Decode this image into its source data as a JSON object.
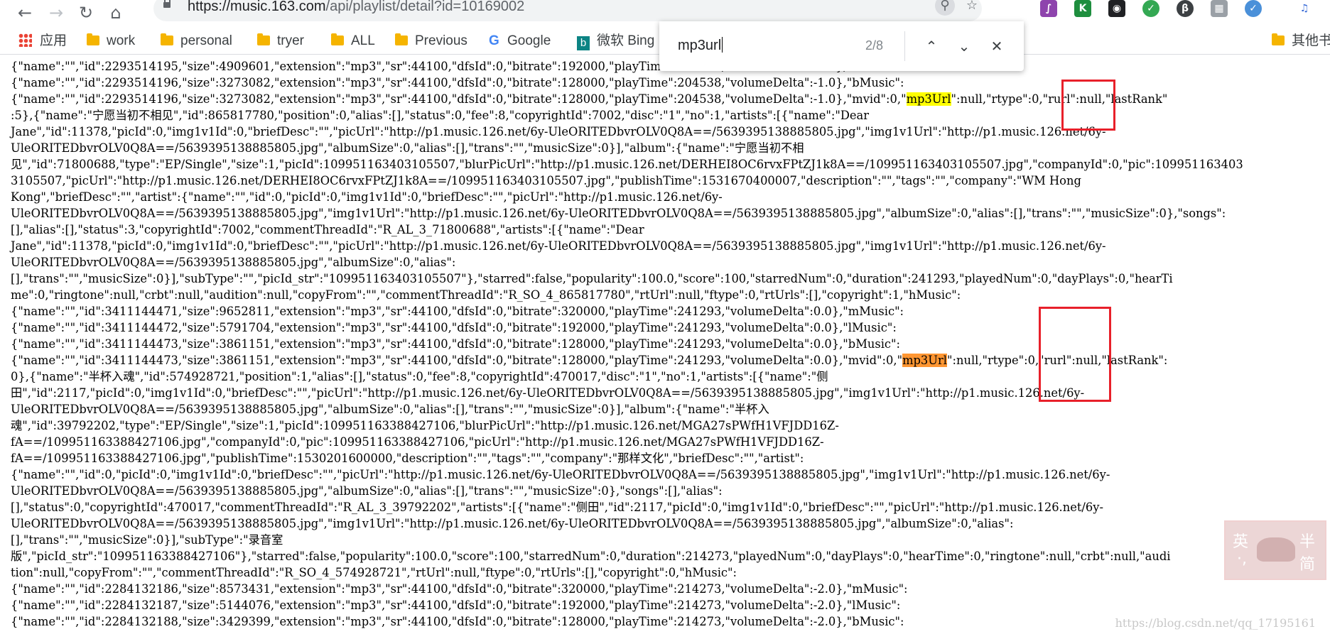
{
  "browser": {
    "url_host": "https://music.163.com",
    "url_path": "/api/playlist/detail?id=10169002",
    "bookmarks": [
      {
        "label": "应用",
        "icon": "apps-icon"
      },
      {
        "label": "work",
        "icon": "folder-icon"
      },
      {
        "label": "personal",
        "icon": "folder-icon"
      },
      {
        "label": "tryer",
        "icon": "folder-icon"
      },
      {
        "label": "ALL",
        "icon": "folder-icon"
      },
      {
        "label": "Previous",
        "icon": "folder-icon"
      },
      {
        "label": "Google",
        "icon": "google-icon"
      },
      {
        "label": "微软 Bing",
        "icon": "bing-icon"
      },
      {
        "label": "其他书",
        "icon": "folder-icon"
      }
    ]
  },
  "find_bar": {
    "query": "mp3url",
    "count": "2/8"
  },
  "content": {
    "segments": [
      {
        "text": "{\"name\":\"\",\"id\":2293514195,\"size\":4909601,\"extension\":\"mp3\",\"sr\":44100,\"dfsId\":0,\"bitrate\":192000,\"playTime\":204538,\"volumeDelta\":-1.0},\"lMusic\":\n{\"name\":\"\",\"id\":2293514196,\"size\":3273082,\"extension\":\"mp3\",\"sr\":44100,\"dfsId\":0,\"bitrate\":128000,\"playTime\":204538,\"volumeDelta\":-1.0},\"bMusic\":\n{\"name\":\"\",\"id\":2293514196,\"size\":3273082,\"extension\":\"mp3\",\"sr\":44100,\"dfsId\":0,\"bitrate\":128000,\"playTime\":204538,\"volumeDelta\":-1.0},\"mvid\":0,\"",
        "hl": ""
      },
      {
        "text": "mp3Url",
        "hl": "match"
      },
      {
        "text": "\":null,\"rtype\":0,\"rurl\":null,\"lastRank\"\n:5},{\"name\":\"宁愿当初不相见\",\"id\":865817780,\"position\":0,\"alias\":[],\"status\":0,\"fee\":8,\"copyrightId\":7002,\"disc\":\"1\",\"no\":1,\"artists\":[{\"name\":\"Dear\nJane\",\"id\":11378,\"picId\":0,\"img1v1Id\":0,\"briefDesc\":\"\",\"picUrl\":\"http://p1.music.126.net/6y-UleORITEDbvrOLV0Q8A==/5639395138885805.jpg\",\"img1v1Url\":\"http://p1.music.126.net/6y-\nUleORITEDbvrOLV0Q8A==/5639395138885805.jpg\",\"albumSize\":0,\"alias\":[],\"trans\":\"\",\"musicSize\":0}],\"album\":{\"name\":\"宁愿当初不相\n见\",\"id\":71800688,\"type\":\"EP/Single\",\"size\":1,\"picId\":109951163403105507,\"blurPicUrl\":\"http://p1.music.126.net/DERHEI8OC6rvxFPtZJ1k8A==/109951163403105507.jpg\",\"companyId\":0,\"pic\":109951163403\n3105507,\"picUrl\":\"http://p1.music.126.net/DERHEI8OC6rvxFPtZJ1k8A==/109951163403105507.jpg\",\"publishTime\":1531670400007,\"description\":\"\",\"tags\":\"\",\"company\":\"WM Hong\nKong\",\"briefDesc\":\"\",\"artist\":{\"name\":\"\",\"id\":0,\"picId\":0,\"img1v1Id\":0,\"briefDesc\":\"\",\"picUrl\":\"http://p1.music.126.net/6y-\nUleORITEDbvrOLV0Q8A==/5639395138885805.jpg\",\"img1v1Url\":\"http://p1.music.126.net/6y-UleORITEDbvrOLV0Q8A==/5639395138885805.jpg\",\"albumSize\":0,\"alias\":[],\"trans\":\"\",\"musicSize\":0},\"songs\":\n[],\"alias\":[],\"status\":3,\"copyrightId\":7002,\"commentThreadId\":\"R_AL_3_71800688\",\"artists\":[{\"name\":\"Dear\nJane\",\"id\":11378,\"picId\":0,\"img1v1Id\":0,\"briefDesc\":\"\",\"picUrl\":\"http://p1.music.126.net/6y-UleORITEDbvrOLV0Q8A==/5639395138885805.jpg\",\"img1v1Url\":\"http://p1.music.126.net/6y-\nUleORITEDbvrOLV0Q8A==/5639395138885805.jpg\",\"albumSize\":0,\"alias\":\n[],\"trans\":\"\",\"musicSize\":0}],\"subType\":\"\",\"picId_str\":\"109951163403105507\"},\"starred\":false,\"popularity\":100.0,\"score\":100,\"starredNum\":0,\"duration\":241293,\"playedNum\":0,\"dayPlays\":0,\"hearTi\nme\":0,\"ringtone\":null,\"crbt\":null,\"audition\":null,\"copyFrom\":\"\",\"commentThreadId\":\"R_SO_4_865817780\",\"rtUrl\":null,\"ftype\":0,\"rtUrls\":[],\"copyright\":1,\"hMusic\":\n{\"name\":\"\",\"id\":3411144471,\"size\":9652811,\"extension\":\"mp3\",\"sr\":44100,\"dfsId\":0,\"bitrate\":320000,\"playTime\":241293,\"volumeDelta\":0.0},\"mMusic\":\n{\"name\":\"\",\"id\":3411144472,\"size\":5791704,\"extension\":\"mp3\",\"sr\":44100,\"dfsId\":0,\"bitrate\":192000,\"playTime\":241293,\"volumeDelta\":0.0},\"lMusic\":\n{\"name\":\"\",\"id\":3411144473,\"size\":3861151,\"extension\":\"mp3\",\"sr\":44100,\"dfsId\":0,\"bitrate\":128000,\"playTime\":241293,\"volumeDelta\":0.0},\"bMusic\":\n{\"name\":\"\",\"id\":3411144473,\"size\":3861151,\"extension\":\"mp3\",\"sr\":44100,\"dfsId\":0,\"bitrate\":128000,\"playTime\":241293,\"volumeDelta\":0.0},\"mvid\":0,\"",
        "hl": ""
      },
      {
        "text": "mp3Url",
        "hl": "current"
      },
      {
        "text": "\":null,\"rtype\":0,\"rurl\":null,\"lastRank\":\n0},{\"name\":\"半杯入魂\",\"id\":574928721,\"position\":1,\"alias\":[],\"status\":0,\"fee\":8,\"copyrightId\":470017,\"disc\":\"1\",\"no\":1,\"artists\":[{\"name\":\"侧\n田\",\"id\":2117,\"picId\":0,\"img1v1Id\":0,\"briefDesc\":\"\",\"picUrl\":\"http://p1.music.126.net/6y-UleORITEDbvrOLV0Q8A==/5639395138885805.jpg\",\"img1v1Url\":\"http://p1.music.126.net/6y-\nUleORITEDbvrOLV0Q8A==/5639395138885805.jpg\",\"albumSize\":0,\"alias\":[],\"trans\":\"\",\"musicSize\":0}],\"album\":{\"name\":\"半杯入\n魂\",\"id\":39792202,\"type\":\"EP/Single\",\"size\":1,\"picId\":109951163388427106,\"blurPicUrl\":\"http://p1.music.126.net/MGA27sPWfH1VFJDD16Z-\nfA==/109951163388427106.jpg\",\"companyId\":0,\"pic\":109951163388427106,\"picUrl\":\"http://p1.music.126.net/MGA27sPWfH1VFJDD16Z-\nfA==/109951163388427106.jpg\",\"publishTime\":1530201600000,\"description\":\"\",\"tags\":\"\",\"company\":\"那样文化\",\"briefDesc\":\"\",\"artist\":\n{\"name\":\"\",\"id\":0,\"picId\":0,\"img1v1Id\":0,\"briefDesc\":\"\",\"picUrl\":\"http://p1.music.126.net/6y-UleORITEDbvrOLV0Q8A==/5639395138885805.jpg\",\"img1v1Url\":\"http://p1.music.126.net/6y-\nUleORITEDbvrOLV0Q8A==/5639395138885805.jpg\",\"albumSize\":0,\"alias\":[],\"trans\":\"\",\"musicSize\":0},\"songs\":[],\"alias\":\n[],\"status\":0,\"copyrightId\":470017,\"commentThreadId\":\"R_AL_3_39792202\",\"artists\":[{\"name\":\"侧田\",\"id\":2117,\"picId\":0,\"img1v1Id\":0,\"briefDesc\":\"\",\"picUrl\":\"http://p1.music.126.net/6y-\nUleORITEDbvrOLV0Q8A==/5639395138885805.jpg\",\"img1v1Url\":\"http://p1.music.126.net/6y-UleORITEDbvrOLV0Q8A==/5639395138885805.jpg\",\"albumSize\":0,\"alias\":\n[],\"trans\":\"\",\"musicSize\":0}],\"subType\":\"录音室\n版\",\"picId_str\":\"109951163388427106\"},\"starred\":false,\"popularity\":100.0,\"score\":100,\"starredNum\":0,\"duration\":214273,\"playedNum\":0,\"dayPlays\":0,\"hearTime\":0,\"ringtone\":null,\"crbt\":null,\"audi\ntion\":null,\"copyFrom\":\"\",\"commentThreadId\":\"R_SO_4_574928721\",\"rtUrl\":null,\"ftype\":0,\"rtUrls\":[],\"copyright\":0,\"hMusic\":\n{\"name\":\"\",\"id\":2284132186,\"size\":8573431,\"extension\":\"mp3\",\"sr\":44100,\"dfsId\":0,\"bitrate\":320000,\"playTime\":214273,\"volumeDelta\":-2.0},\"mMusic\":\n{\"name\":\"\",\"id\":2284132187,\"size\":5144076,\"extension\":\"mp3\",\"sr\":44100,\"dfsId\":0,\"bitrate\":192000,\"playTime\":214273,\"volumeDelta\":-2.0},\"lMusic\":\n{\"name\":\"\",\"id\":2284132188,\"size\":3429399,\"extension\":\"mp3\",\"sr\":44100,\"dfsId\":0,\"bitrate\":128000,\"playTime\":214273,\"volumeDelta\":-2.0},\"bMusic\":",
        "hl": ""
      }
    ]
  },
  "watermark": {
    "chars": [
      "英",
      "半",
      "简",
      "·,"
    ],
    "blog_url": "https://blog.csdn.net/qq_17195161"
  },
  "colors": {
    "match_highlight": "#ffff00",
    "current_match_highlight": "#ff9632",
    "annotation_box": "#e8202a"
  }
}
